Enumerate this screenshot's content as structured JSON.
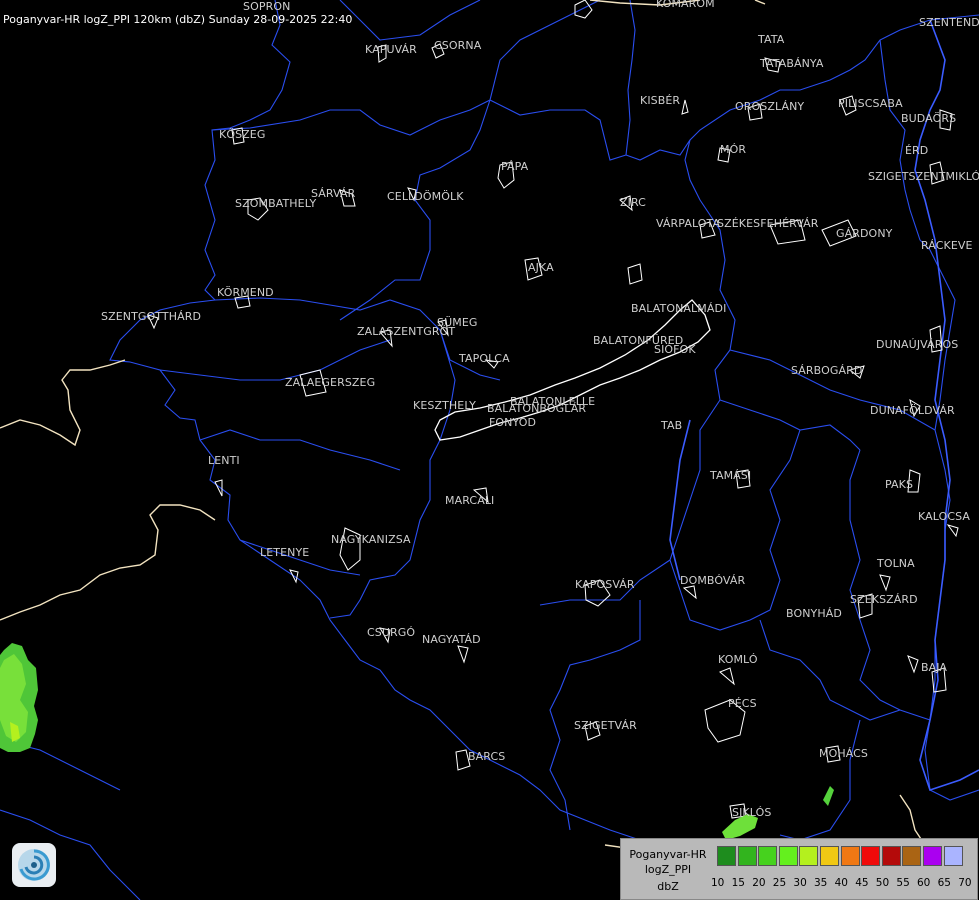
{
  "header": {
    "title": "Poganyvar-HR logZ_PPI 120km (dbZ) Sunday 28-09-2025 22:40"
  },
  "cities": [
    {
      "name": "SOPRON"
    },
    {
      "name": "KOMAROM"
    },
    {
      "name": "SZENTENDRE"
    },
    {
      "name": "KAPUVÁR"
    },
    {
      "name": "CSORNA"
    },
    {
      "name": "TATA"
    },
    {
      "name": "TATABÁNYA"
    },
    {
      "name": "KISBÉR"
    },
    {
      "name": "OROSZLÁNY"
    },
    {
      "name": "PILISCSABA"
    },
    {
      "name": "BUDAÖRS"
    },
    {
      "name": "KŐSZEG"
    },
    {
      "name": "MÓR"
    },
    {
      "name": "ÉRD"
    },
    {
      "name": "SZIGETSZENTMIKLÓS"
    },
    {
      "name": "PÁPA"
    },
    {
      "name": "SÁRVÁR"
    },
    {
      "name": "CELLDÖMÖLK"
    },
    {
      "name": "SZOMBATHELY"
    },
    {
      "name": "ZIRC"
    },
    {
      "name": "VÁRPALOTA"
    },
    {
      "name": "SZÉKESFEHÉRVÁR"
    },
    {
      "name": "GÁRDONY"
    },
    {
      "name": "RÁCKEVE"
    },
    {
      "name": "AJKA"
    },
    {
      "name": "KÖRMEND"
    },
    {
      "name": "BALATONALMÁDI"
    },
    {
      "name": "SZENTGOTTHÁRD"
    },
    {
      "name": "SÜMEG"
    },
    {
      "name": "ZALASZENTGRÓT"
    },
    {
      "name": "BALATONFÜRED"
    },
    {
      "name": "SIÓFOK"
    },
    {
      "name": "DUNAÚJVÁROS"
    },
    {
      "name": "TAPOLCA"
    },
    {
      "name": "ZALAEGERSZEG"
    },
    {
      "name": "SÁRBOGÁRD"
    },
    {
      "name": "BALATONLELLE"
    },
    {
      "name": "KESZTHELY"
    },
    {
      "name": "BALATONBOGLÁR"
    },
    {
      "name": "DUNAFÖLDVÁR"
    },
    {
      "name": "FONYÓD"
    },
    {
      "name": "TAB"
    },
    {
      "name": "LENTI"
    },
    {
      "name": "TAMÁSI"
    },
    {
      "name": "PAKS"
    },
    {
      "name": "MARCALI"
    },
    {
      "name": "KALOCSA"
    },
    {
      "name": "LETENYE"
    },
    {
      "name": "NAGYKANIZSA"
    },
    {
      "name": "TOLNA"
    },
    {
      "name": "KAPOSVÁR"
    },
    {
      "name": "DOMBÓVÁR"
    },
    {
      "name": "SZEKSZÁRD"
    },
    {
      "name": "BONYHÁD"
    },
    {
      "name": "CSURGÓ"
    },
    {
      "name": "NAGYATÁD"
    },
    {
      "name": "KOMLÓ"
    },
    {
      "name": "BAJA"
    },
    {
      "name": "PÉCS"
    },
    {
      "name": "SZIGETVÁR"
    },
    {
      "name": "MOHÁCS"
    },
    {
      "name": "BARCS"
    },
    {
      "name": "SIKLÓS"
    }
  ],
  "legend": {
    "line1": "Poganyvar-HR",
    "line2": "logZ_PPI",
    "line3": "dbZ",
    "colors": [
      "#1e8c1e",
      "#32b41e",
      "#46d21e",
      "#64f01e",
      "#b4f01e",
      "#f0c814",
      "#f07814",
      "#f00a0a",
      "#b40a0a",
      "#aa6414",
      "#aa00f0",
      "#aab4ff"
    ],
    "ticks": [
      "10",
      "15",
      "20",
      "25",
      "30",
      "35",
      "40",
      "45",
      "50",
      "55",
      "60",
      "65",
      "70"
    ]
  },
  "colors": {
    "rivers": "#2a4ef0",
    "borders": "#f2e3c0",
    "roads": "#ffffff",
    "rain": "#55d23c"
  }
}
